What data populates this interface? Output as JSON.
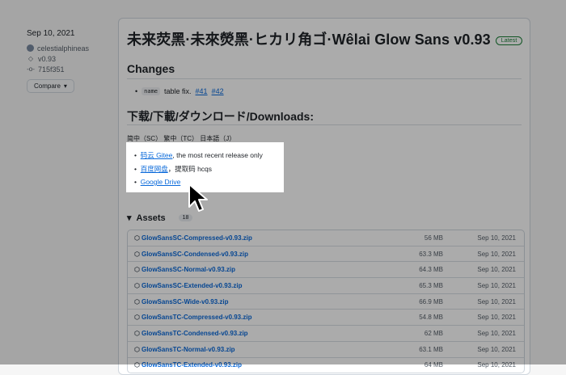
{
  "meta": {
    "date": "Sep 10, 2021",
    "author": "celestialphineas",
    "tag": "v0.93",
    "commit": "715f351",
    "compare_label": "Compare"
  },
  "release": {
    "title": "未来荧黑·未來熒黑·ヒカリ角ゴ·Wêlai Glow Sans v0.93",
    "badge": "Latest",
    "changes_heading": "Changes",
    "change_items": [
      {
        "code": "name",
        "text": "table fix.",
        "links": [
          "#41",
          "#42"
        ]
      }
    ],
    "downloads_heading": "下载/下載/ダウンロード/Downloads:",
    "languages": "简中（SC） 繁中（TC） 日本語（J）",
    "download_links": [
      {
        "link": "码云 Gitee",
        "rest": ", the most recent release only"
      },
      {
        "link": "百度网盘",
        "rest": "，提取码 hcqs"
      },
      {
        "link": "Google Drive",
        "rest": ""
      }
    ]
  },
  "assets": {
    "heading": "Assets",
    "count": "18",
    "items": [
      {
        "name": "GlowSansSC-Compressed-v0.93.zip",
        "size": "56 MB",
        "date": "Sep 10, 2021"
      },
      {
        "name": "GlowSansSC-Condensed-v0.93.zip",
        "size": "63.3 MB",
        "date": "Sep 10, 2021"
      },
      {
        "name": "GlowSansSC-Normal-v0.93.zip",
        "size": "64.3 MB",
        "date": "Sep 10, 2021"
      },
      {
        "name": "GlowSansSC-Extended-v0.93.zip",
        "size": "65.3 MB",
        "date": "Sep 10, 2021"
      },
      {
        "name": "GlowSansSC-Wide-v0.93.zip",
        "size": "66.9 MB",
        "date": "Sep 10, 2021"
      },
      {
        "name": "GlowSansTC-Compressed-v0.93.zip",
        "size": "54.8 MB",
        "date": "Sep 10, 2021"
      },
      {
        "name": "GlowSansTC-Condensed-v0.93.zip",
        "size": "62 MB",
        "date": "Sep 10, 2021"
      },
      {
        "name": "GlowSansTC-Normal-v0.93.zip",
        "size": "63.1 MB",
        "date": "Sep 10, 2021"
      },
      {
        "name": "GlowSansTC-Extended-v0.93.zip",
        "size": "64 MB",
        "date": "Sep 10, 2021"
      }
    ]
  },
  "icons": {
    "tag": "tag-icon",
    "commit": "commit-icon",
    "package": "package-icon",
    "cursor": "mouse-pointer-icon"
  },
  "colors": {
    "link": "#0969da",
    "latest_badge": "#1a7f37",
    "overlay": "rgba(0,0,0,0.33)"
  }
}
